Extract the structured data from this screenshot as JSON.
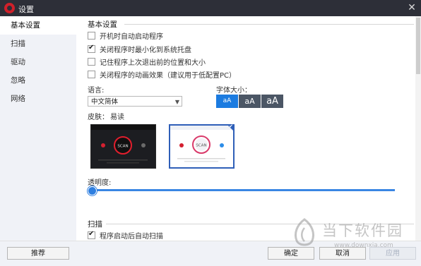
{
  "window": {
    "title": "设置",
    "close_glyph": "✕"
  },
  "sidebar": {
    "items": [
      {
        "label": "基本设置",
        "active": true
      },
      {
        "label": "扫描",
        "active": false
      },
      {
        "label": "驱动",
        "active": false
      },
      {
        "label": "忽略",
        "active": false
      },
      {
        "label": "网络",
        "active": false
      }
    ]
  },
  "basic": {
    "heading": "基本设置",
    "options": [
      {
        "label": "开机时自动启动程序",
        "checked": false
      },
      {
        "label": "关闭程序时最小化到系统托盘",
        "checked": true
      },
      {
        "label": "记住程序上次退出前的位置和大小",
        "checked": false
      },
      {
        "label": "关闭程序的动画效果（建议用于低配置PC）",
        "checked": false
      }
    ],
    "language_label": "语言:",
    "language_value": "中文简体",
    "font_size_label": "字体大小：",
    "font_sizes": [
      {
        "label": "aA",
        "active": true
      },
      {
        "label": "aA",
        "active": false
      },
      {
        "label": "aA",
        "active": false
      }
    ],
    "skin_label": "皮肤：",
    "skin_value": "易读",
    "skins": [
      {
        "name": "dark-skin",
        "scan_text": "SCAN",
        "selected": false
      },
      {
        "name": "light-skin",
        "scan_text": "SCAN",
        "selected": true
      }
    ],
    "transparency_label": "透明度:",
    "transparency_value": 0
  },
  "scan": {
    "heading": "扫描",
    "options": [
      {
        "label": "程序启动后自动扫描",
        "checked": true
      }
    ]
  },
  "footer": {
    "recommend_label": "推荐",
    "ok_label": "确定",
    "cancel_label": "取消",
    "apply_label": "应用"
  },
  "watermark": {
    "text": "当下软件园",
    "url": "www.downxia.com"
  },
  "colors": {
    "accent": "#1b7be0",
    "titlebar": "#2d2f38",
    "sidebar": "#f0f2f7"
  },
  "icons": {
    "app": "app-logo-icon",
    "close": "close-icon",
    "dropdown": "chevron-down-icon",
    "check": "check-icon"
  }
}
